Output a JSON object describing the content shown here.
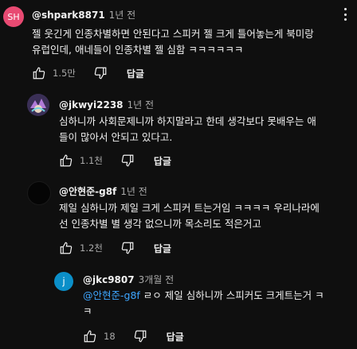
{
  "comments": [
    {
      "avatar_text": "SH",
      "avatar_color": "#e84a72",
      "author": "@shpark8871",
      "time": "1년 전",
      "text_lines": [
        "젤 웃긴게 인종차별하면 안된다고 스피커 젤 크게 틀어놓는게 북미랑",
        "유럽인데, 애네들이 인종차별 젤 심함 ㅋㅋㅋㅋㅋㅋ"
      ],
      "likes": "1.5만",
      "reply_label": "답글"
    },
    {
      "avatar_text": "",
      "avatar_color": "#3a2f56",
      "author": "@jkwyi2238",
      "time": "1년 전",
      "text_lines": [
        "심하니까 사회문제니까 하지말라고 한데  생각보다 못배우는 애",
        "들이 많아서 안되고 있다고."
      ],
      "likes": "1.1천",
      "reply_label": "답글"
    },
    {
      "avatar_text": "",
      "avatar_color": "#050505",
      "author": "@안현준-g8f",
      "time": "1년 전",
      "text_lines": [
        "제일 심하니까 제일 크게 스피커 트는거임 ㅋㅋㅋㅋ 우리나라에",
        "선 인종차별 별 생각 없으니까 목소리도 적은거고"
      ],
      "likes": "1.2천",
      "reply_label": "답글"
    },
    {
      "avatar_text": "j",
      "avatar_color": "#0b8fc9",
      "author": "@jkc9807",
      "time": "3개월 전",
      "mention": "@안현준-g8f",
      "text_line1_rest": " ㄹㅇ 제일 심하니까 스피커도 크게트는거 ㅋ",
      "text_line2": "ㅋ",
      "likes": "18",
      "reply_label": "답글"
    }
  ]
}
